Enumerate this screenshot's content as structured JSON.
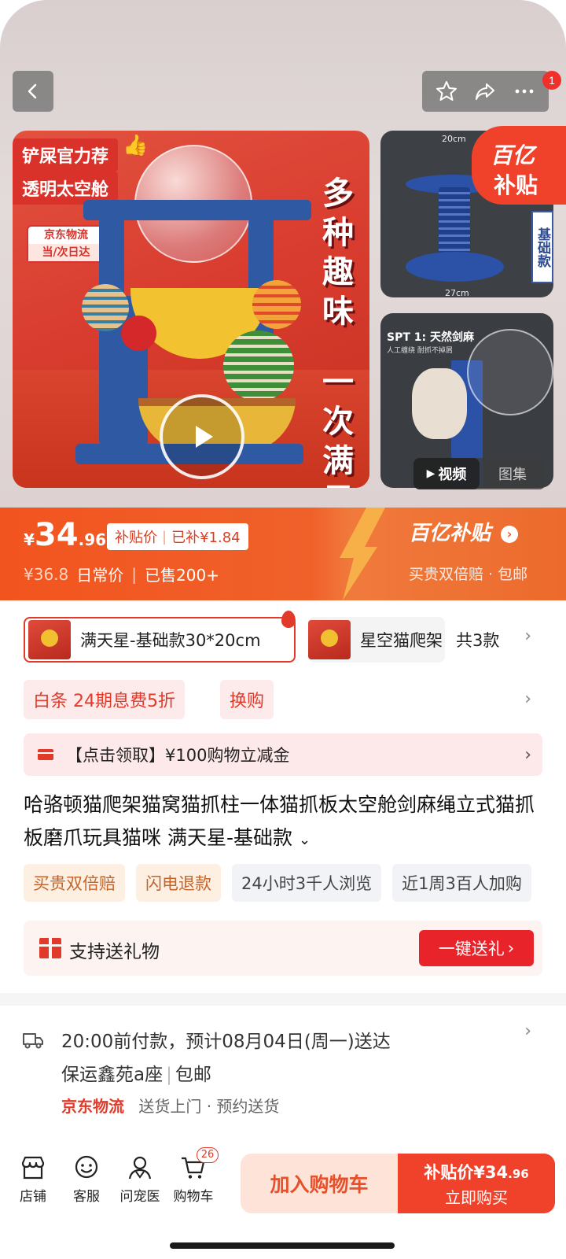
{
  "gallery": {
    "cart_badge_count": "1",
    "main_image": {
      "tag_line1": "铲屎官力荐",
      "tag_line2": "透明太空舱",
      "logistics_line1": "京东物流",
      "logistics_line2": "当/次日达",
      "vertical_text1": "多种趣味",
      "vertical_text2": "一次满足"
    },
    "side_image1": {
      "badge_line1": "百亿",
      "badge_line2": "补贴",
      "variant_tag": "基础款",
      "dim_top": "20cm",
      "dim_bottom": "27cm"
    },
    "side_image2": {
      "title": "SPT 1: 天然剑麻",
      "subtitle": "人工缠绕 耐抓不掉屑"
    },
    "media_tabs": [
      "视频",
      "图集"
    ]
  },
  "price": {
    "currency": "¥",
    "integer": "34",
    "decimal": ".96",
    "subsidy_label": "补贴价",
    "subsidy_amount": "已补¥1.84",
    "original_price": "¥36.8",
    "original_label": "日常价",
    "sold": "已售200+",
    "program_name": "百亿补贴",
    "program_sub": "买贵双倍赔 · 包邮"
  },
  "variants": {
    "selected_label": "满天星-基础款30*20cm",
    "second_label": "星空猫爬架",
    "count_label": "共3款"
  },
  "finance": {
    "baitiao": "白条  24期息费5折",
    "exchange": "换购",
    "coupon_text": "【点击领取】¥100购物立减金"
  },
  "product": {
    "title": "哈骆顿猫爬架猫窝猫抓柱一体猫抓板太空舱剑麻绳立式猫抓板磨爪玩具猫咪 满天星-基础款",
    "tags": [
      {
        "label": "买贵双倍赔"
      },
      {
        "label": "闪电退款"
      },
      {
        "label": "24小时3千人浏览"
      },
      {
        "label": "近1周3百人加购"
      }
    ]
  },
  "gift": {
    "label": "支持送礼物",
    "button": "一键送礼"
  },
  "delivery": {
    "line1": "20:00前付款，预计08月04日(周一)送达",
    "address": "保运鑫苑a座",
    "shipping": "包邮",
    "carrier": "京东物流",
    "services": "送货上门 · 预约送货"
  },
  "bottom_nav": {
    "items": [
      {
        "label": "店铺",
        "icon": "store-icon"
      },
      {
        "label": "客服",
        "icon": "service-icon"
      },
      {
        "label": "问宠医",
        "icon": "vet-icon"
      },
      {
        "label": "购物车",
        "icon": "cart-icon"
      }
    ],
    "cart_count": "26",
    "add_to_cart": "加入购物车",
    "buy_price_label": "补贴价¥34",
    "buy_price_decimal": ".96",
    "buy_now": "立即购买"
  },
  "colors": {
    "accent": "#f0412a",
    "price_banner": "#f2541f",
    "red_text": "#e23a2a"
  }
}
